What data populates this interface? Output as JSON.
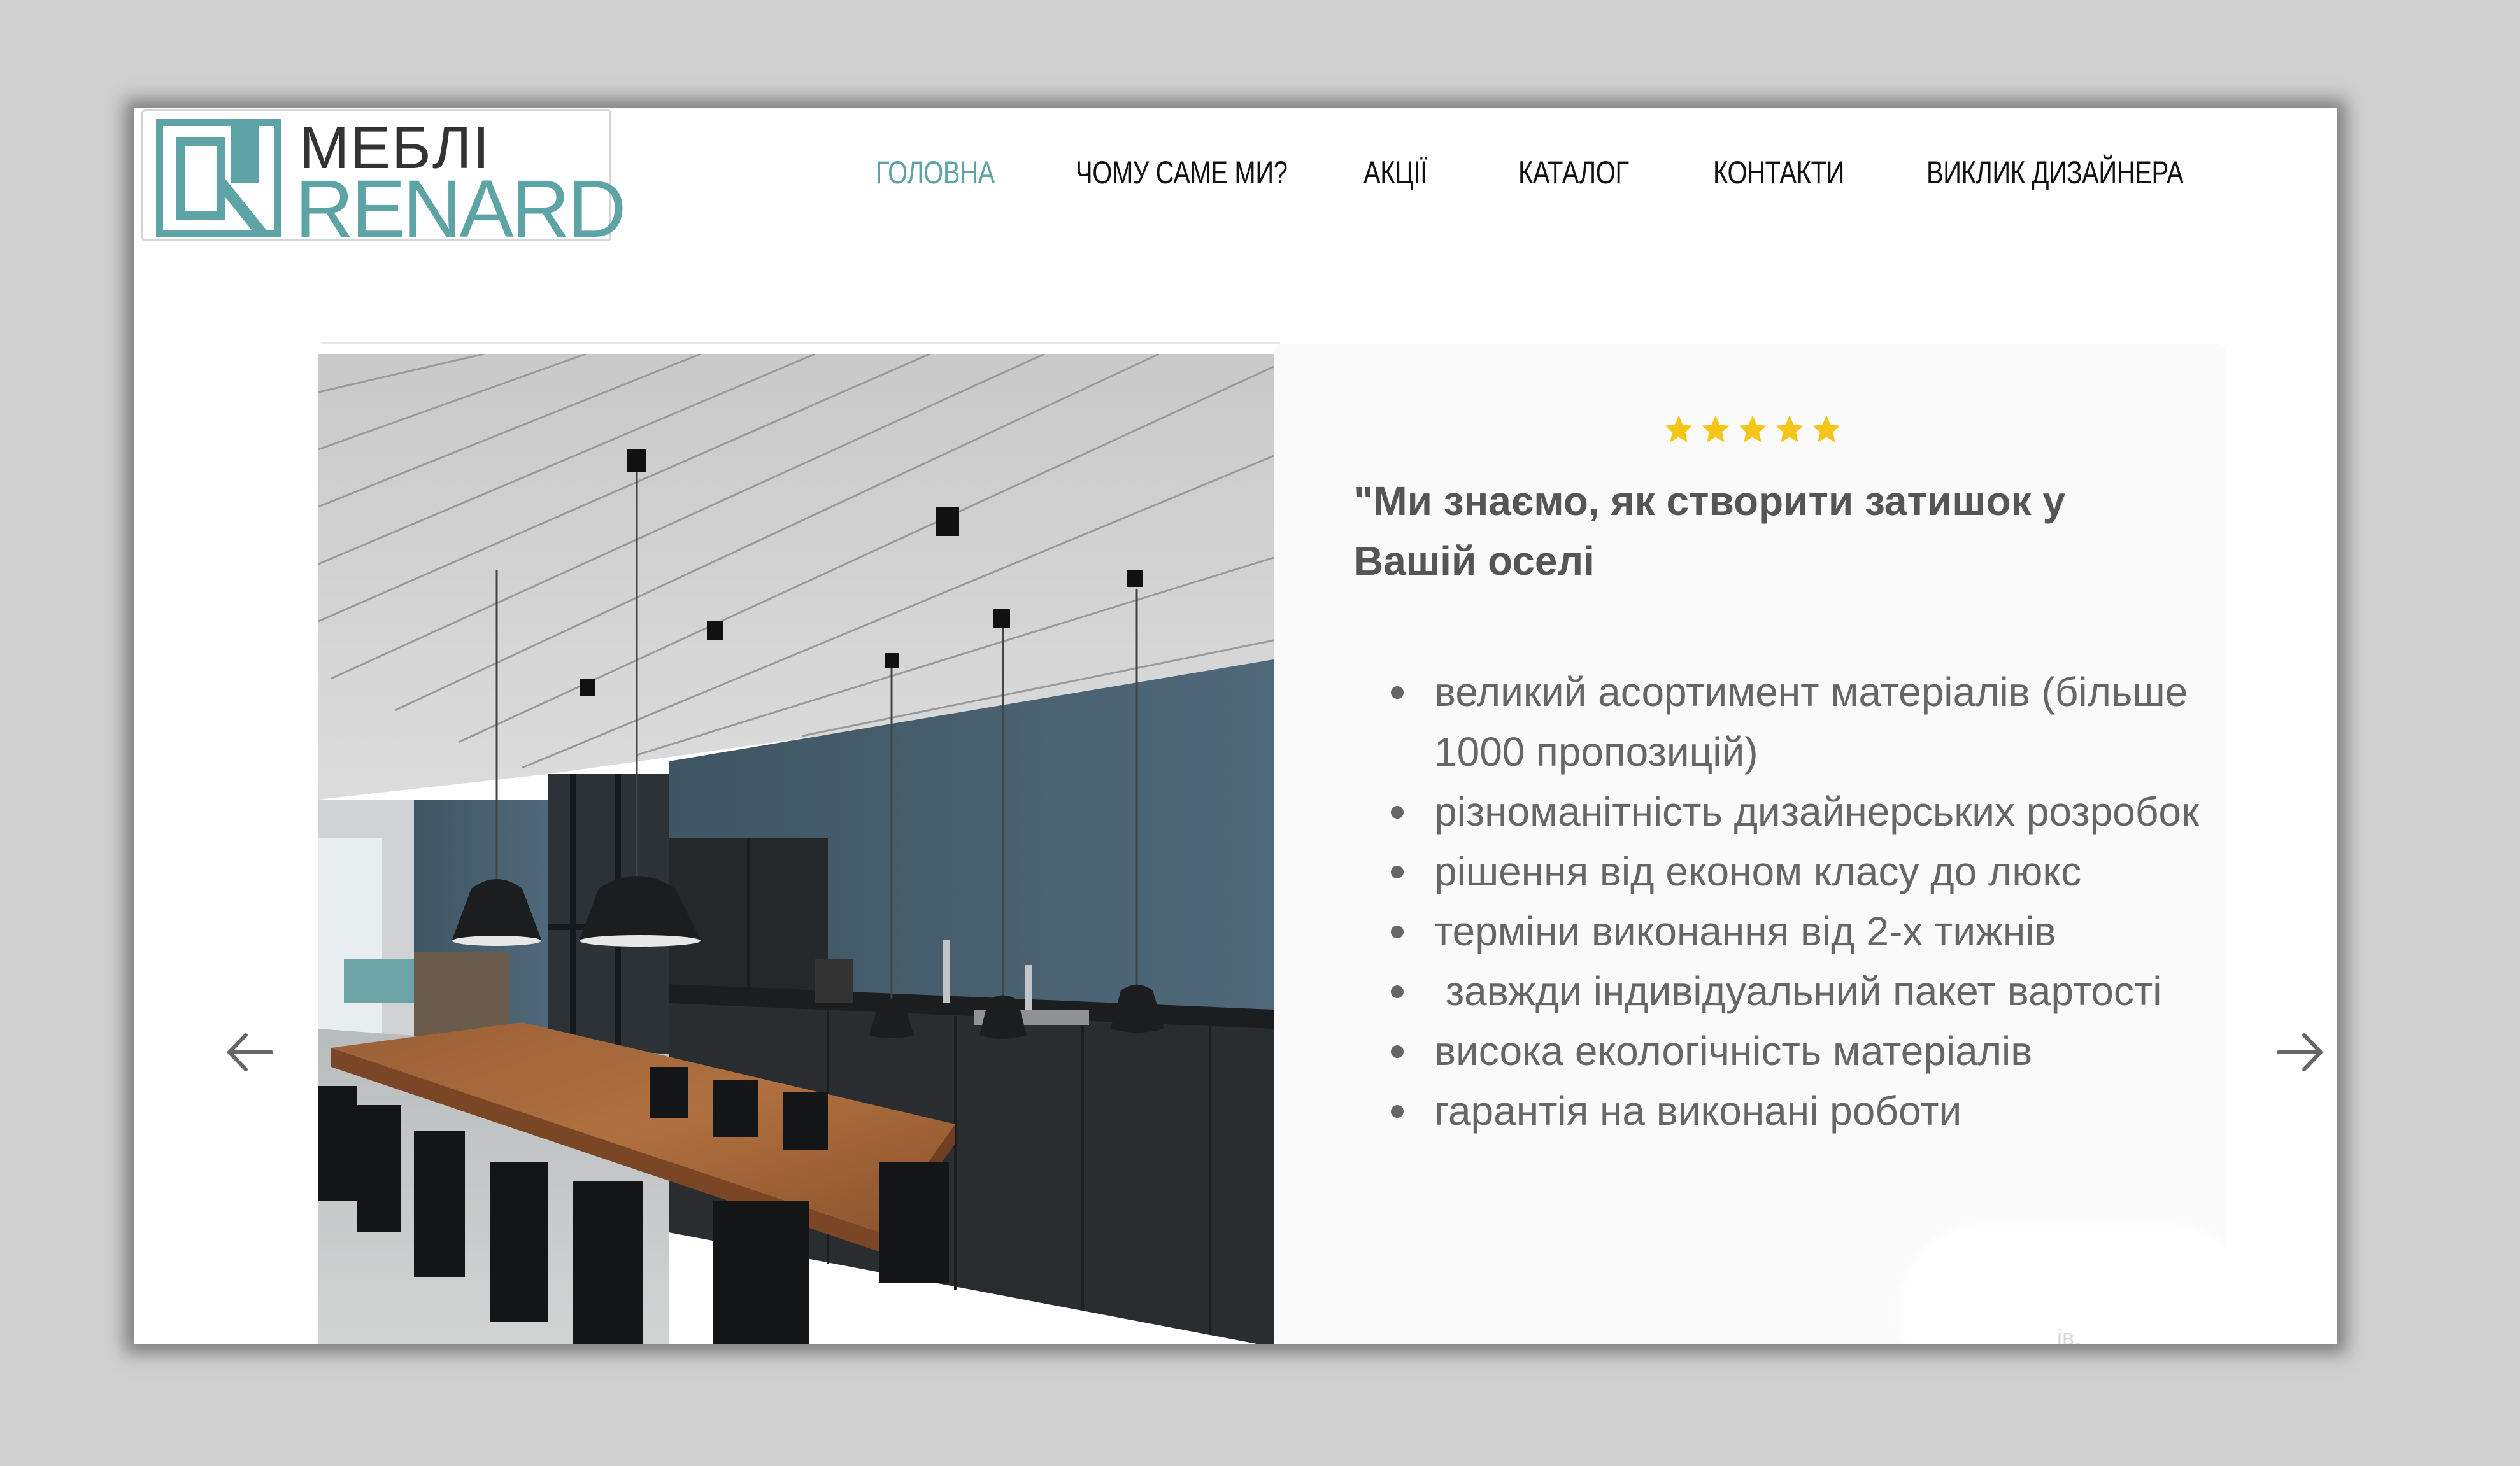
{
  "logo": {
    "top_text": "МЕБЛІ",
    "bottom_text": "RENARD"
  },
  "nav": {
    "items": [
      {
        "label": "ГОЛОВНА",
        "active": true
      },
      {
        "label": "ЧОМУ САМЕ МИ?",
        "active": false
      },
      {
        "label": "АКЦІЇ",
        "active": false
      },
      {
        "label": "КАТАЛОГ",
        "active": false
      },
      {
        "label": "КОНТАКТИ",
        "active": false
      },
      {
        "label": "ВИКЛИК ДИЗАЙНЕРА",
        "active": false
      }
    ]
  },
  "slide": {
    "rating": 5,
    "headline": "\"Ми знаємо, як створити затишок у Вашій оселі",
    "features": [
      "великий асортимент матеріалів (більше 1000 пропозицій)",
      "різноманітність дизайнерських розробок",
      "рішення від економ класу до люкс",
      "терміни виконання від 2-х тижнів",
      " завжди індивідуальний пакет вартості",
      "висока екологічність матеріалів",
      "гарантія на виконані роботи"
    ],
    "closing_quote": "\"",
    "obscured_text": "ів,"
  },
  "icons": {
    "prev": "arrow-left-icon",
    "next": "arrow-right-icon",
    "star": "star-icon"
  },
  "colors": {
    "accent": "#5ea3a5",
    "star": "#f5c518",
    "nav_text": "#111111",
    "body_text": "#666666"
  }
}
